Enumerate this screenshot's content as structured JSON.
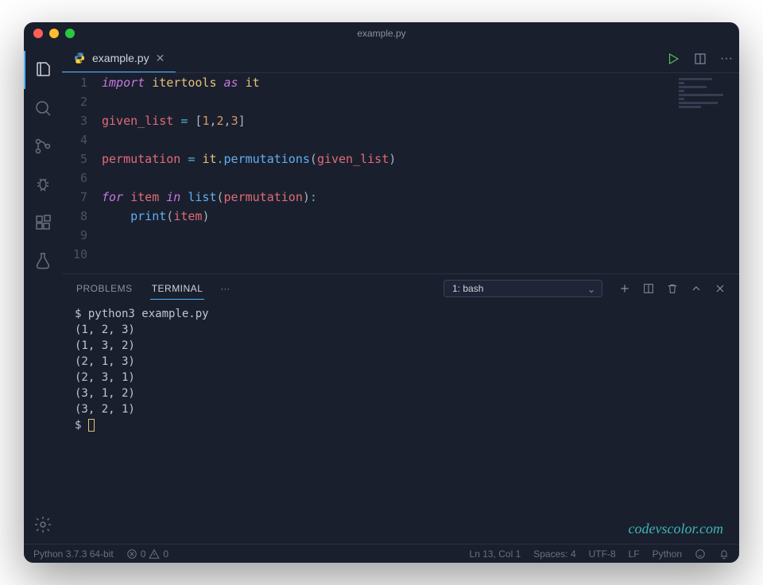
{
  "title": "example.py",
  "tab": {
    "filename": "example.py"
  },
  "code": {
    "lines": [
      {
        "n": 1,
        "tokens": [
          [
            "kw",
            "import"
          ],
          [
            "sp",
            " "
          ],
          [
            "mod",
            "itertools"
          ],
          [
            "sp",
            " "
          ],
          [
            "kw",
            "as"
          ],
          [
            "sp",
            " "
          ],
          [
            "mod",
            "it"
          ]
        ]
      },
      {
        "n": 2,
        "tokens": []
      },
      {
        "n": 3,
        "tokens": [
          [
            "var",
            "given_list"
          ],
          [
            "sp",
            " "
          ],
          [
            "op",
            "="
          ],
          [
            "sp",
            " "
          ],
          [
            "paren",
            "["
          ],
          [
            "num",
            "1"
          ],
          [
            "comma",
            ","
          ],
          [
            "num",
            "2"
          ],
          [
            "comma",
            ","
          ],
          [
            "num",
            "3"
          ],
          [
            "paren",
            "]"
          ]
        ]
      },
      {
        "n": 4,
        "tokens": []
      },
      {
        "n": 5,
        "tokens": [
          [
            "var",
            "permutation"
          ],
          [
            "sp",
            " "
          ],
          [
            "op",
            "="
          ],
          [
            "sp",
            " "
          ],
          [
            "mod",
            "it"
          ],
          [
            "op",
            "."
          ],
          [
            "fn",
            "permutations"
          ],
          [
            "paren",
            "("
          ],
          [
            "var",
            "given_list"
          ],
          [
            "paren",
            ")"
          ]
        ]
      },
      {
        "n": 6,
        "tokens": []
      },
      {
        "n": 7,
        "tokens": [
          [
            "kw",
            "for"
          ],
          [
            "sp",
            " "
          ],
          [
            "var",
            "item"
          ],
          [
            "sp",
            " "
          ],
          [
            "kw",
            "in"
          ],
          [
            "sp",
            " "
          ],
          [
            "fn",
            "list"
          ],
          [
            "paren",
            "("
          ],
          [
            "var",
            "permutation"
          ],
          [
            "paren",
            ")"
          ],
          [
            "op",
            ":"
          ]
        ]
      },
      {
        "n": 8,
        "tokens": [
          [
            "sp",
            "    "
          ],
          [
            "fn",
            "print"
          ],
          [
            "paren",
            "("
          ],
          [
            "var",
            "item"
          ],
          [
            "paren",
            ")"
          ]
        ]
      },
      {
        "n": 9,
        "tokens": []
      },
      {
        "n": 10,
        "tokens": []
      }
    ]
  },
  "panel": {
    "tabs": {
      "problems": "PROBLEMS",
      "terminal": "TERMINAL"
    },
    "terminal_label": "1: bash",
    "output": [
      "$ python3 example.py",
      "(1, 2, 3)",
      "(1, 3, 2)",
      "(2, 1, 3)",
      "(2, 3, 1)",
      "(3, 1, 2)",
      "(3, 2, 1)",
      "$ "
    ]
  },
  "status": {
    "interpreter": "Python 3.7.3 64-bit",
    "errors": "0",
    "warnings": "0",
    "cursor": "Ln 13, Col 1",
    "spaces": "Spaces: 4",
    "encoding": "UTF-8",
    "eol": "LF",
    "language": "Python"
  },
  "watermark": "codevscolor.com"
}
